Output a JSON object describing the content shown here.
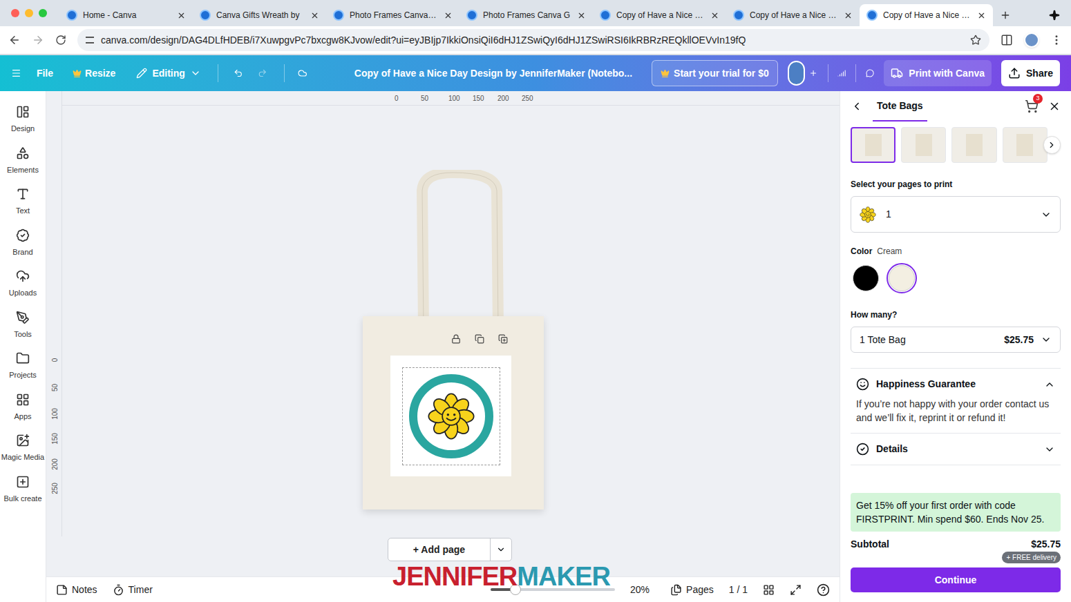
{
  "browser": {
    "tabs": [
      {
        "label": "Home - Canva",
        "selected": false
      },
      {
        "label": "Canva Gifts Wreath by",
        "selected": false
      },
      {
        "label": "Photo Frames Canva Gi",
        "selected": false
      },
      {
        "label": "Photo Frames Canva G",
        "selected": false
      },
      {
        "label": "Copy of Have a Nice Da",
        "selected": false
      },
      {
        "label": "Copy of Have a Nice Da",
        "selected": false
      },
      {
        "label": "Copy of Have a Nice Da",
        "selected": true
      }
    ],
    "url": "canva.com/design/DAG4DLfHDEB/i7XuwpgvPc7bxcgw8KJvow/edit?ui=eyJBIjp7IkkiOnsiQiI6dHJ1ZSwiQyI6dHJ1ZSwiRSI6IkRBRzREQkllOEVvIn19fQ"
  },
  "toolbar": {
    "file": "File",
    "resize": "Resize",
    "editing": "Editing",
    "title": "Copy of Have a Nice Day Design by JenniferMaker (Notebo...",
    "trial": "Start your trial for $0",
    "print": "Print with Canva",
    "share": "Share"
  },
  "sidebar": {
    "items": [
      "Design",
      "Elements",
      "Text",
      "Brand",
      "Uploads",
      "Tools",
      "Projects",
      "Apps",
      "Magic Media",
      "Bulk create"
    ]
  },
  "canvas": {
    "ruler_top": [
      "0",
      "50",
      "100",
      "150",
      "200",
      "250"
    ],
    "ruler_left": [
      "0",
      "50",
      "100",
      "150",
      "200",
      "250"
    ],
    "add_page": "+ Add page"
  },
  "bottom_bar": {
    "notes": "Notes",
    "timer": "Timer",
    "zoom": "20%",
    "zoom_level": 0.2,
    "pages": "Pages",
    "page_count": "1 / 1"
  },
  "watermark": [
    "JENNIFER",
    "MAKER"
  ],
  "panel": {
    "title": "Tote Bags",
    "cart_count": "3",
    "thumbnails": [
      {
        "selected": true
      },
      {
        "selected": false
      },
      {
        "selected": false
      },
      {
        "selected": false
      }
    ],
    "pages_label": "Select your pages to print",
    "pages_value": "1",
    "color_label": "Color",
    "color_value": "Cream",
    "swatches": [
      {
        "color": "#000000",
        "selected": false
      },
      {
        "color": "#f3efe2",
        "selected": true
      }
    ],
    "quantity_label": "How many?",
    "quantity": "1 Tote Bag",
    "price": "$25.75",
    "sections": [
      {
        "title": "Happiness Guarantee",
        "expanded": true,
        "body": "If you’re not happy with your order contact us and we’ll fix it, reprint it or refund it!"
      },
      {
        "title": "Details",
        "expanded": false,
        "body": ""
      }
    ],
    "promo": "Get 15% off your first order with code FIRSTPRINT. Min spend $60. Ends Nov 25.",
    "subtotal_label": "Subtotal",
    "subtotal": "$25.75",
    "delivery": "+ FREE delivery",
    "continue": "Continue"
  }
}
